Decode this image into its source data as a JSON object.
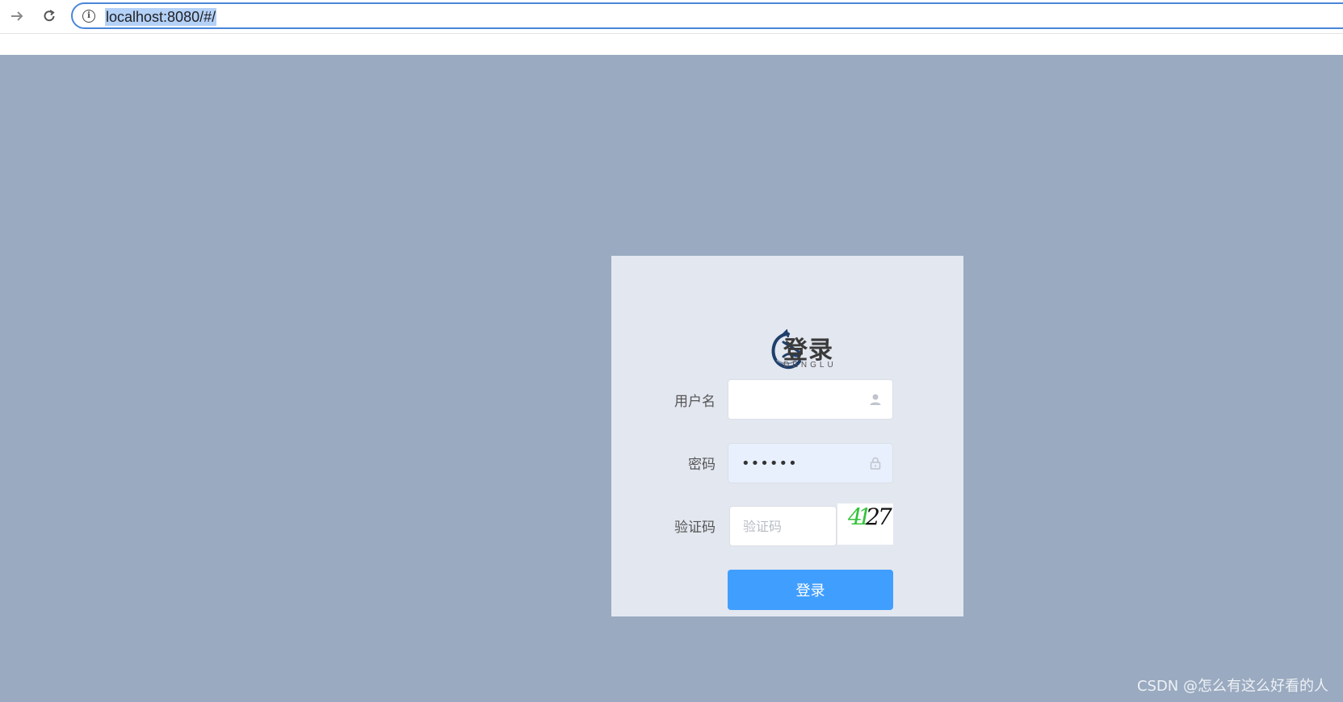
{
  "browser": {
    "url": "localhost:8080/#/"
  },
  "logo": {
    "title": "登录",
    "subtitle": "DENGLU"
  },
  "form": {
    "username_label": "用户名",
    "username_value": "",
    "password_label": "密码",
    "password_value": "123456",
    "captcha_label": "验证码",
    "captcha_placeholder": "验证码",
    "captcha_digits": [
      {
        "char": "4",
        "color": "#33c43a"
      },
      {
        "char": "1",
        "color": "#33c43a"
      },
      {
        "char": "2",
        "color": "#111111"
      },
      {
        "char": "7",
        "color": "#111111"
      }
    ],
    "login_button": "登录"
  },
  "watermark": "CSDN @怎么有这么好看的人",
  "colors": {
    "page_bg": "#9aaac0",
    "card_bg": "#e3e7f0",
    "primary": "#409eff"
  }
}
